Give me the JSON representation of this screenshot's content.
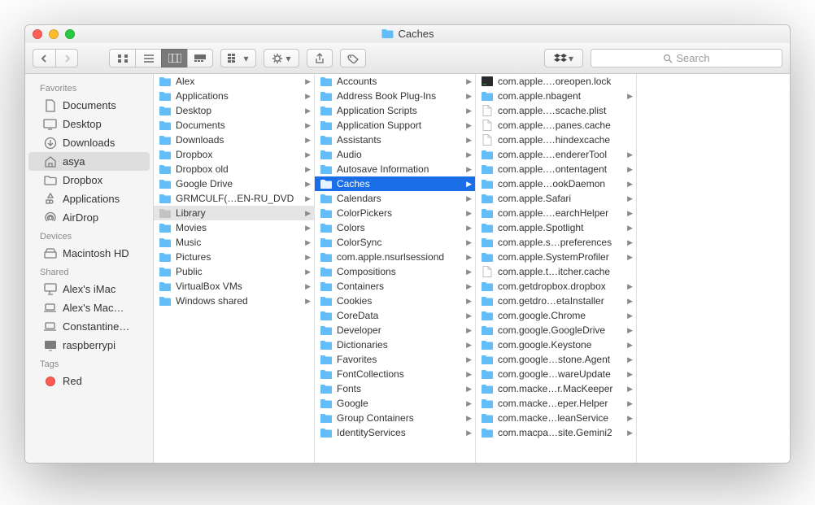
{
  "window_title": "Caches",
  "search_placeholder": "Search",
  "sidebar": {
    "sections": [
      {
        "label": "Favorites",
        "items": [
          {
            "label": "Documents",
            "icon": "doc"
          },
          {
            "label": "Desktop",
            "icon": "desktop"
          },
          {
            "label": "Downloads",
            "icon": "downloads"
          },
          {
            "label": "asya",
            "icon": "home",
            "selected": true
          },
          {
            "label": "Dropbox",
            "icon": "folder"
          },
          {
            "label": "Applications",
            "icon": "apps"
          },
          {
            "label": "AirDrop",
            "icon": "airdrop"
          }
        ]
      },
      {
        "label": "Devices",
        "items": [
          {
            "label": "Macintosh HD",
            "icon": "disk"
          }
        ]
      },
      {
        "label": "Shared",
        "items": [
          {
            "label": "Alex's iMac",
            "icon": "imac"
          },
          {
            "label": "Alex's Mac…",
            "icon": "laptop"
          },
          {
            "label": "Constantine…",
            "icon": "laptop"
          },
          {
            "label": "raspberrypi",
            "icon": "display"
          }
        ]
      },
      {
        "label": "Tags",
        "items": [
          {
            "label": "Red",
            "icon": "tag",
            "color": "#ff5a52"
          }
        ]
      }
    ]
  },
  "columns": [
    {
      "items": [
        {
          "label": "Alex",
          "icon": "folder",
          "arrow": true
        },
        {
          "label": "Applications",
          "icon": "folder",
          "arrow": true
        },
        {
          "label": "Desktop",
          "icon": "folder",
          "arrow": true
        },
        {
          "label": "Documents",
          "icon": "folder",
          "arrow": true
        },
        {
          "label": "Downloads",
          "icon": "folder",
          "arrow": true
        },
        {
          "label": "Dropbox",
          "icon": "folder",
          "arrow": true
        },
        {
          "label": "Dropbox old",
          "icon": "folder",
          "arrow": true
        },
        {
          "label": "Google Drive",
          "icon": "folder",
          "arrow": true
        },
        {
          "label": "GRMCULF(…EN-RU_DVD",
          "icon": "folder",
          "arrow": true
        },
        {
          "label": "Library",
          "icon": "folder-gray",
          "arrow": true,
          "selected": "gray"
        },
        {
          "label": "Movies",
          "icon": "folder",
          "arrow": true
        },
        {
          "label": "Music",
          "icon": "folder",
          "arrow": true
        },
        {
          "label": "Pictures",
          "icon": "folder",
          "arrow": true
        },
        {
          "label": "Public",
          "icon": "folder",
          "arrow": true
        },
        {
          "label": "VirtualBox VMs",
          "icon": "folder",
          "arrow": true
        },
        {
          "label": "Windows shared",
          "icon": "folder",
          "arrow": true
        }
      ]
    },
    {
      "items": [
        {
          "label": "Accounts",
          "icon": "folder",
          "arrow": true
        },
        {
          "label": "Address Book Plug-Ins",
          "icon": "folder",
          "arrow": true
        },
        {
          "label": "Application Scripts",
          "icon": "folder",
          "arrow": true
        },
        {
          "label": "Application Support",
          "icon": "folder",
          "arrow": true
        },
        {
          "label": "Assistants",
          "icon": "folder",
          "arrow": true
        },
        {
          "label": "Audio",
          "icon": "folder",
          "arrow": true
        },
        {
          "label": "Autosave Information",
          "icon": "folder",
          "arrow": true
        },
        {
          "label": "Caches",
          "icon": "folder-white",
          "arrow": true,
          "selected": "blue"
        },
        {
          "label": "Calendars",
          "icon": "folder",
          "arrow": true
        },
        {
          "label": "ColorPickers",
          "icon": "folder",
          "arrow": true
        },
        {
          "label": "Colors",
          "icon": "folder",
          "arrow": true
        },
        {
          "label": "ColorSync",
          "icon": "folder",
          "arrow": true
        },
        {
          "label": "com.apple.nsurlsessiond",
          "icon": "folder",
          "arrow": true
        },
        {
          "label": "Compositions",
          "icon": "folder",
          "arrow": true
        },
        {
          "label": "Containers",
          "icon": "folder",
          "arrow": true
        },
        {
          "label": "Cookies",
          "icon": "folder",
          "arrow": true
        },
        {
          "label": "CoreData",
          "icon": "folder",
          "arrow": true
        },
        {
          "label": "Developer",
          "icon": "folder",
          "arrow": true
        },
        {
          "label": "Dictionaries",
          "icon": "folder",
          "arrow": true
        },
        {
          "label": "Favorites",
          "icon": "folder",
          "arrow": true
        },
        {
          "label": "FontCollections",
          "icon": "folder",
          "arrow": true
        },
        {
          "label": "Fonts",
          "icon": "folder",
          "arrow": true
        },
        {
          "label": "Google",
          "icon": "folder",
          "arrow": true
        },
        {
          "label": "Group Containers",
          "icon": "folder",
          "arrow": true
        },
        {
          "label": "IdentityServices",
          "icon": "folder",
          "arrow": true
        }
      ]
    },
    {
      "items": [
        {
          "label": "com.apple.…oreopen.lock",
          "icon": "exec"
        },
        {
          "label": "com.apple.nbagent",
          "icon": "folder",
          "arrow": true
        },
        {
          "label": "com.apple.…scache.plist",
          "icon": "file"
        },
        {
          "label": "com.apple.…panes.cache",
          "icon": "file-blank"
        },
        {
          "label": "com.apple.…hindexcache",
          "icon": "file-blank"
        },
        {
          "label": "com.apple.…endererTool",
          "icon": "folder",
          "arrow": true
        },
        {
          "label": "com.apple.…ontentagent",
          "icon": "folder",
          "arrow": true
        },
        {
          "label": "com.apple…ookDaemon",
          "icon": "folder",
          "arrow": true
        },
        {
          "label": "com.apple.Safari",
          "icon": "folder",
          "arrow": true
        },
        {
          "label": "com.apple.…earchHelper",
          "icon": "folder",
          "arrow": true
        },
        {
          "label": "com.apple.Spotlight",
          "icon": "folder",
          "arrow": true
        },
        {
          "label": "com.apple.s…preferences",
          "icon": "folder",
          "arrow": true
        },
        {
          "label": "com.apple.SystemProfiler",
          "icon": "folder",
          "arrow": true
        },
        {
          "label": "com.apple.t…itcher.cache",
          "icon": "file-blank"
        },
        {
          "label": "com.getdropbox.dropbox",
          "icon": "folder",
          "arrow": true
        },
        {
          "label": "com.getdro…etaInstaller",
          "icon": "folder",
          "arrow": true
        },
        {
          "label": "com.google.Chrome",
          "icon": "folder",
          "arrow": true
        },
        {
          "label": "com.google.GoogleDrive",
          "icon": "folder",
          "arrow": true
        },
        {
          "label": "com.google.Keystone",
          "icon": "folder",
          "arrow": true
        },
        {
          "label": "com.google…stone.Agent",
          "icon": "folder",
          "arrow": true
        },
        {
          "label": "com.google…wareUpdate",
          "icon": "folder",
          "arrow": true
        },
        {
          "label": "com.macke…r.MacKeeper",
          "icon": "folder",
          "arrow": true
        },
        {
          "label": "com.macke…eper.Helper",
          "icon": "folder",
          "arrow": true
        },
        {
          "label": "com.macke…leanService",
          "icon": "folder",
          "arrow": true
        },
        {
          "label": "com.macpa…site.Gemini2",
          "icon": "folder",
          "arrow": true
        }
      ]
    }
  ]
}
